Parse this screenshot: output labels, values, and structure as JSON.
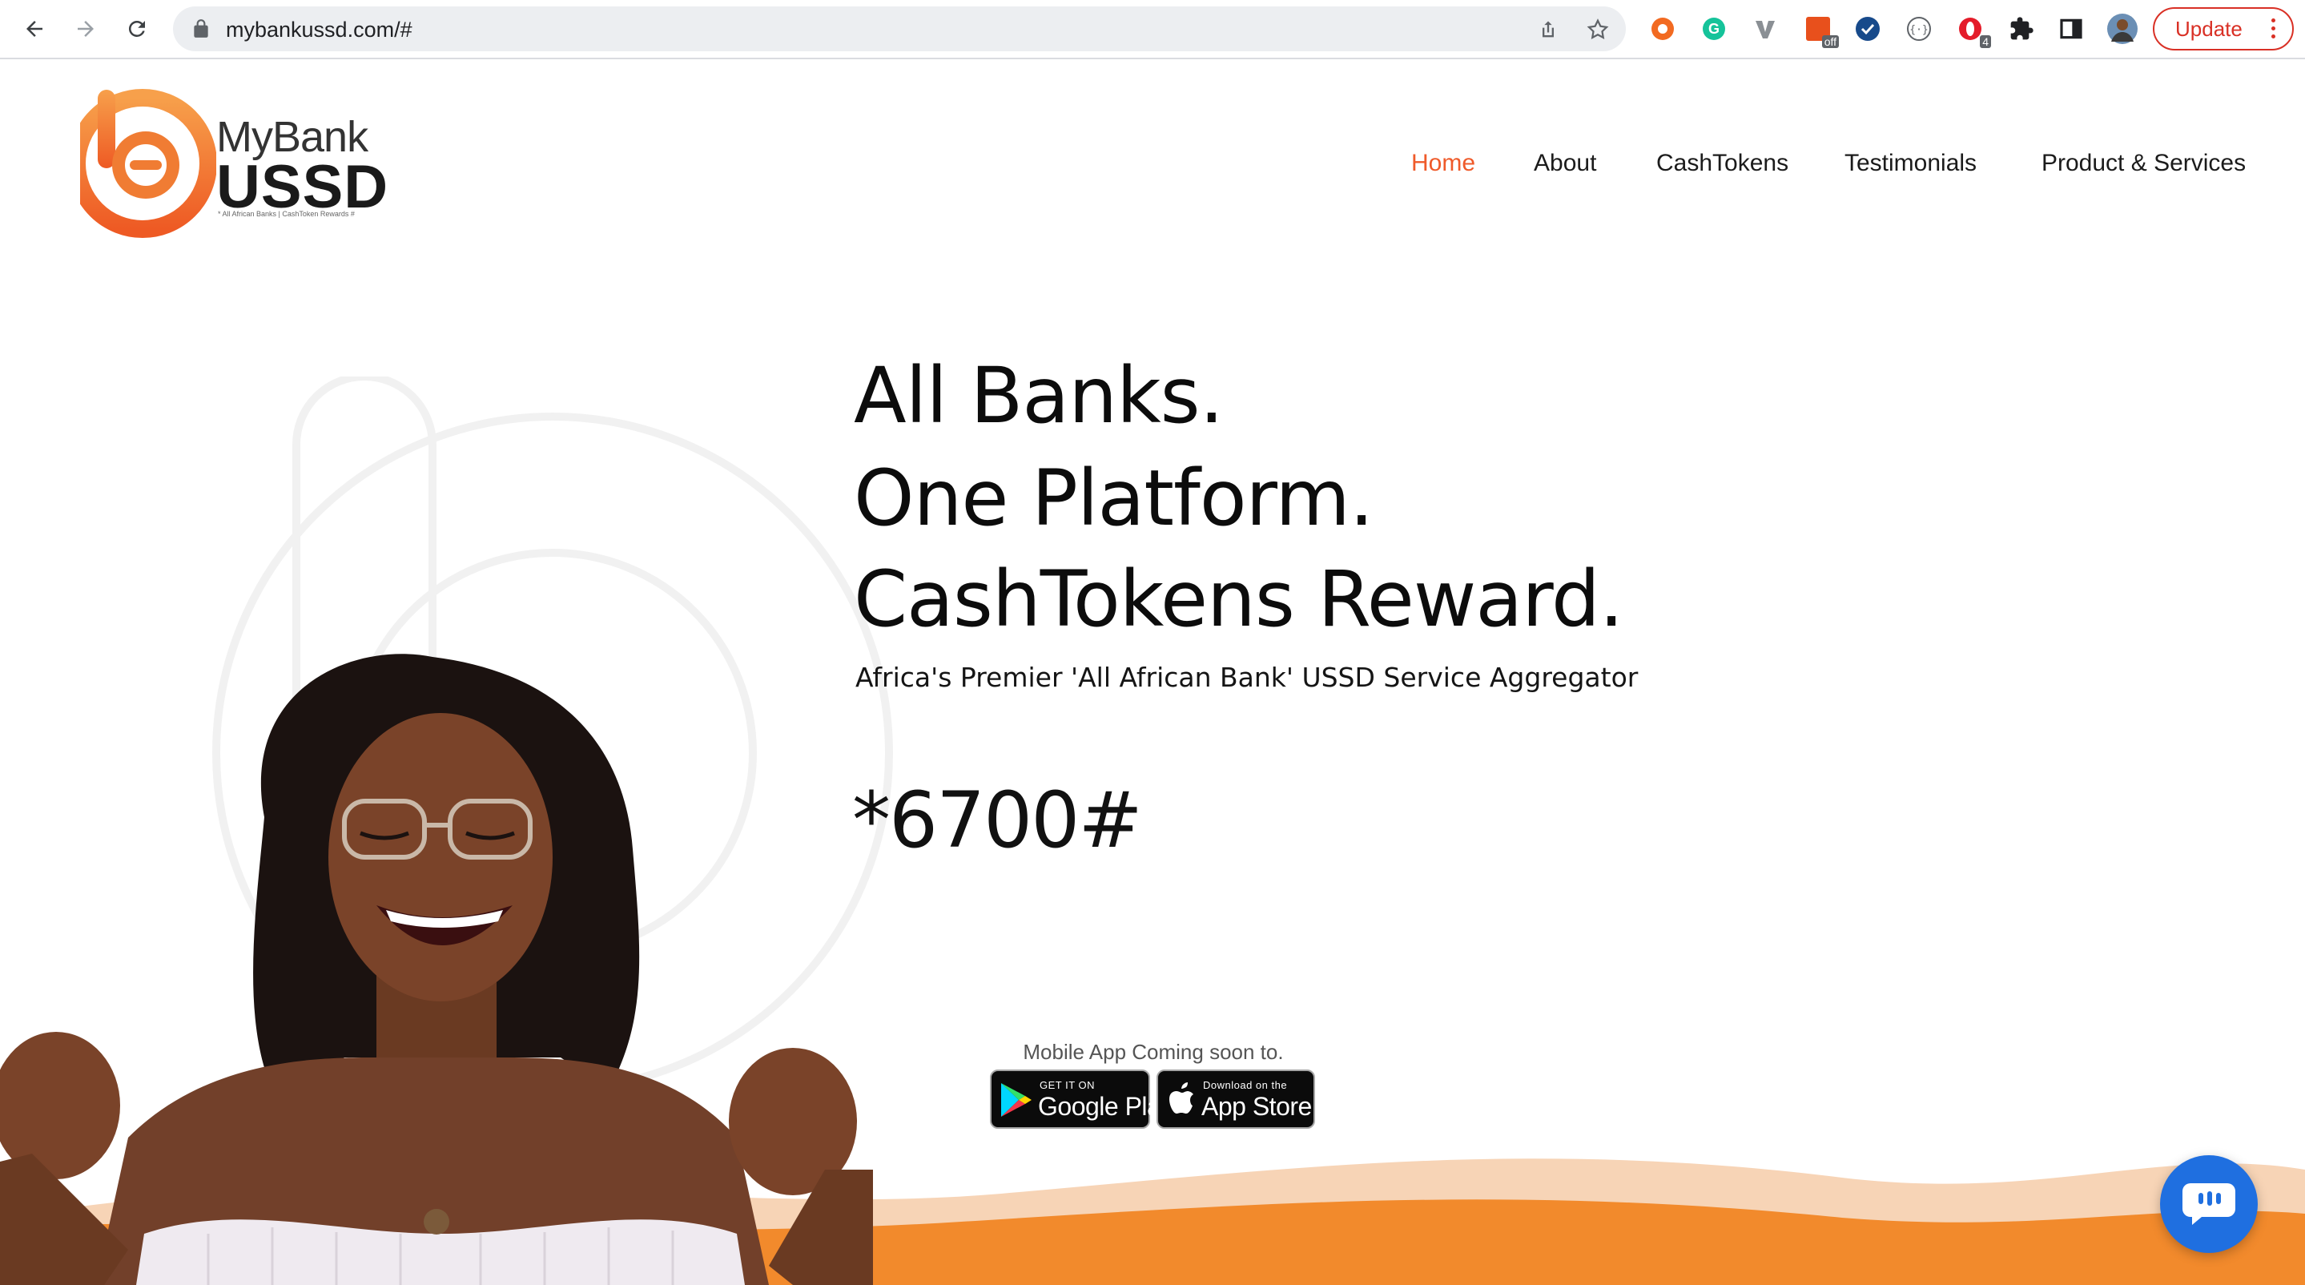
{
  "browser": {
    "url": "mybankussd.com/#",
    "update_label": "Update",
    "extensions": [
      "orange-circle-ext-icon",
      "grammarly-icon",
      "vimeo-ext-icon",
      "off-toggle-ext-icon",
      "blue-check-ext-icon",
      "code-ext-icon",
      "opera-ext-icon",
      "puzzle-icon",
      "sidebar-icon",
      "profile-avatar"
    ],
    "ext_badges": {
      "off": "off",
      "opera": "4"
    }
  },
  "logo": {
    "mybank": "MyBank",
    "ussd": "USSD",
    "tagline": "* All African Banks  | CashToken Rewards #"
  },
  "nav": {
    "items": [
      {
        "label": "Home",
        "active": true
      },
      {
        "label": "About"
      },
      {
        "label": "CashTokens"
      },
      {
        "label": "Testimonials"
      },
      {
        "label": "Product & Services"
      }
    ]
  },
  "hero": {
    "line1": "All Banks.",
    "line2": "One Platform.",
    "line3": "CashTokens Reward.",
    "subtitle": "Africa's Premier 'All African Bank' USSD Service Aggregator",
    "code": "*6700#",
    "coming_soon": "Mobile App Coming soon to.",
    "google_small": "GET IT ON",
    "google_big": "Google Play",
    "apple_small": "Download on the",
    "apple_big": "App Store"
  },
  "colors": {
    "accent": "#ef5a2a",
    "wave_orange": "#f28a2c",
    "wave_peach": "#f7d4b6",
    "chat_blue": "#1f6fe0"
  }
}
